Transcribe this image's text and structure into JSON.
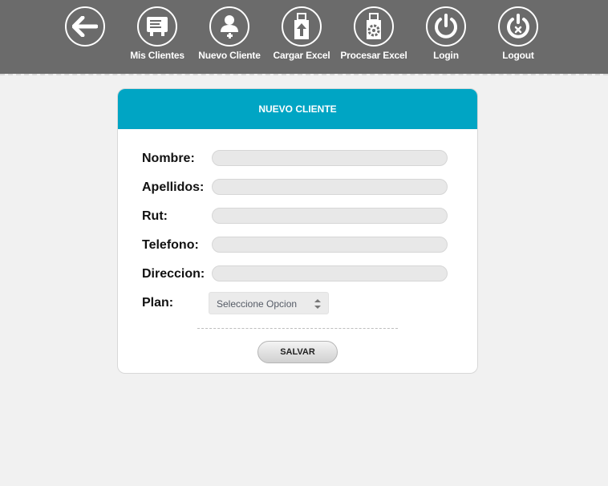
{
  "nav": {
    "items": [
      {
        "label": "",
        "icon": "back-arrow-icon"
      },
      {
        "label": "Mis Clientes",
        "icon": "clients-list-icon"
      },
      {
        "label": "Nuevo Cliente",
        "icon": "add-user-icon"
      },
      {
        "label": "Cargar Excel",
        "icon": "upload-usb-icon"
      },
      {
        "label": "Procesar Excel",
        "icon": "process-usb-gear-icon"
      },
      {
        "label": "Login",
        "icon": "power-icon"
      },
      {
        "label": "Logout",
        "icon": "power-off-icon"
      }
    ]
  },
  "form": {
    "title": "NUEVO CLIENTE",
    "fields": [
      {
        "label": "Nombre:",
        "value": ""
      },
      {
        "label": "Apellidos:",
        "value": ""
      },
      {
        "label": "Rut:",
        "value": ""
      },
      {
        "label": "Telefono:",
        "value": ""
      },
      {
        "label": "Direccion:",
        "value": ""
      }
    ],
    "plan": {
      "label": "Plan:",
      "selected": "Seleccione Opcion"
    },
    "save_label": "SALVAR"
  },
  "colors": {
    "topbar": "#6b6b6b",
    "header_accent": "#00a5c4",
    "page_background": "#f1f1f1"
  }
}
